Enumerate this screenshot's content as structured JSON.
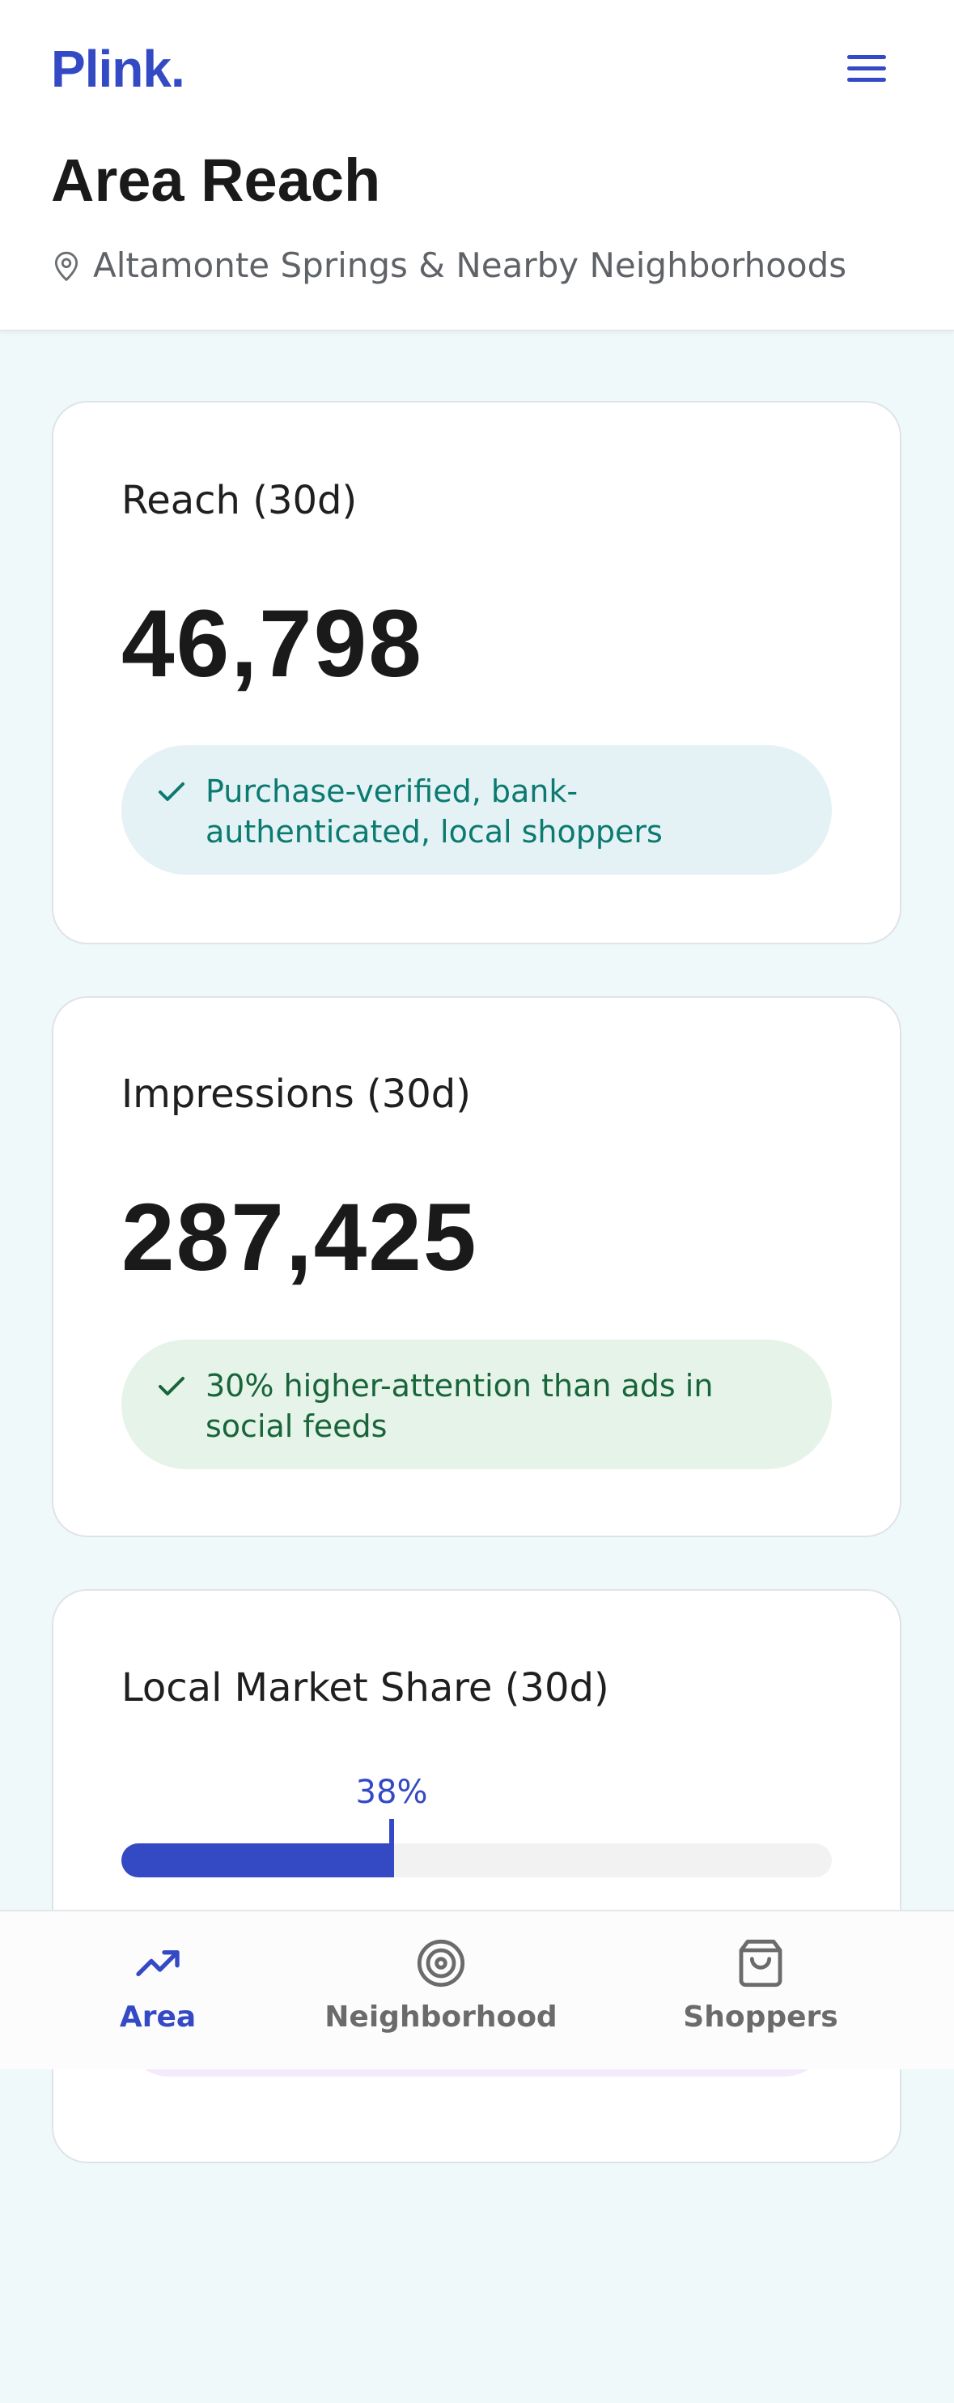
{
  "app": {
    "logo": "Plink."
  },
  "header": {
    "title": "Area Reach",
    "location": "Altamonte Springs & Nearby Neighborhoods"
  },
  "cards": {
    "reach": {
      "label": "Reach (30d)",
      "value": "46,798",
      "note": "Purchase-verified, bank-authenticated, local shoppers"
    },
    "impressions": {
      "label": "Impressions (30d)",
      "value": "287,425",
      "note": "30% higher-attention than ads in social feeds"
    },
    "market_share": {
      "label": "Local Market Share (30d)",
      "percent_label": "38%",
      "percent_value": 0.38
    }
  },
  "bottom_nav": {
    "items": [
      {
        "label": "Area",
        "icon": "trending-up-icon",
        "active": true
      },
      {
        "label": "Neighborhood",
        "icon": "target-icon",
        "active": false
      },
      {
        "label": "Shoppers",
        "icon": "shopping-bag-icon",
        "active": false
      }
    ]
  },
  "colors": {
    "brand": "#3449c4",
    "background": "#eff9fa",
    "pill_teal_text": "#0b7a70",
    "pill_green_text": "#18653a"
  }
}
